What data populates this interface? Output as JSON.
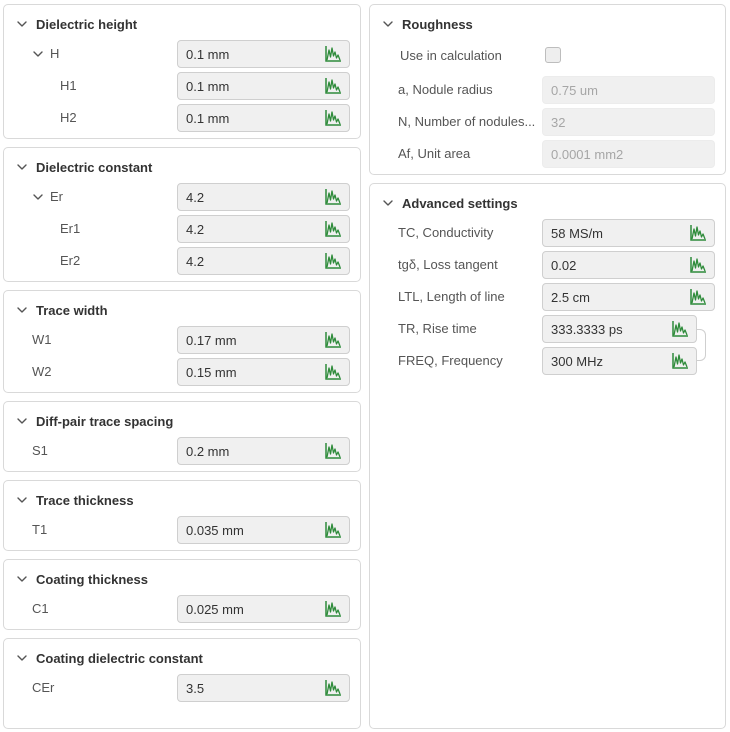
{
  "left_panels": {
    "dielectric_height": {
      "title": "Dielectric height",
      "group_label": "H",
      "group_value": "0.1 mm",
      "rows": [
        {
          "label": "H1",
          "value": "0.1 mm"
        },
        {
          "label": "H2",
          "value": "0.1 mm"
        }
      ]
    },
    "dielectric_constant": {
      "title": "Dielectric constant",
      "group_label": "Er",
      "group_value": "4.2",
      "rows": [
        {
          "label": "Er1",
          "value": "4.2"
        },
        {
          "label": "Er2",
          "value": "4.2"
        }
      ]
    },
    "trace_width": {
      "title": "Trace width",
      "rows": [
        {
          "label": "W1",
          "value": "0.17 mm"
        },
        {
          "label": "W2",
          "value": "0.15 mm"
        }
      ]
    },
    "diff_pair": {
      "title": "Diff-pair trace spacing",
      "rows": [
        {
          "label": "S1",
          "value": "0.2 mm"
        }
      ]
    },
    "trace_thickness": {
      "title": "Trace thickness",
      "rows": [
        {
          "label": "T1",
          "value": "0.035 mm"
        }
      ]
    },
    "coating_thickness": {
      "title": "Coating thickness",
      "rows": [
        {
          "label": "C1",
          "value": "0.025 mm"
        }
      ]
    },
    "coating_dielectric": {
      "title": "Coating dielectric constant",
      "rows": [
        {
          "label": "CEr",
          "value": "3.5"
        }
      ]
    }
  },
  "roughness": {
    "title": "Roughness",
    "use_in_calc_label": "Use in calculation",
    "use_in_calc_checked": false,
    "rows": [
      {
        "label": "a, Nodule radius",
        "value": "0.75 um"
      },
      {
        "label": "N, Number of nodules...",
        "value": "32"
      },
      {
        "label": "Af, Unit area",
        "value": "0.0001 mm2"
      }
    ]
  },
  "advanced": {
    "title": "Advanced settings",
    "rows": [
      {
        "label": "TC, Conductivity",
        "value": "58 MS/m"
      },
      {
        "label": "tgδ, Loss tangent",
        "value": "0.02"
      },
      {
        "label": "LTL, Length of line",
        "value": "2.5 cm"
      },
      {
        "label": "TR, Rise time",
        "value": "333.3333 ps"
      },
      {
        "label": "FREQ, Frequency",
        "value": "300 MHz"
      }
    ]
  },
  "icons": {
    "chevron": "chevron-down-icon",
    "graph": "chart-icon"
  },
  "colors": {
    "graph_icon": "#2e8b3a",
    "field_bg": "#f0f0f0",
    "border": "#d9d9d9"
  }
}
